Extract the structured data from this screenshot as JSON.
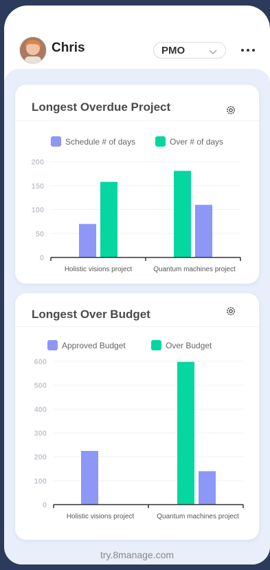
{
  "header": {
    "user_name": "Chris",
    "role": "PMO"
  },
  "cards": [
    {
      "title": "Longest Overdue Project"
    },
    {
      "title": "Longest Over Budget"
    }
  ],
  "footer": {
    "text": "try.8manage.com"
  },
  "chart_data": [
    {
      "type": "bar",
      "categories": [
        "Holistic visions project",
        "Quantum machines project"
      ],
      "series": [
        {
          "name": "Schedule # of days",
          "color": "#8c97f7",
          "values": [
            70,
            110
          ]
        },
        {
          "name": "Over # of days",
          "color": "#06d6a0",
          "values": [
            158,
            181
          ]
        }
      ],
      "bar_order": [
        [
          "Schedule # of days",
          "Over # of days"
        ],
        [
          "Over # of days",
          "Schedule # of days"
        ]
      ],
      "ylim": [
        0,
        200
      ],
      "yticks": [
        0,
        50,
        100,
        150,
        200
      ],
      "grid": true,
      "legend": "top"
    },
    {
      "type": "bar",
      "categories": [
        "Holistic visions project",
        "Quantum machines project"
      ],
      "series": [
        {
          "name": "Approved Budget",
          "color": "#8c97f7",
          "values": [
            0,
            140
          ]
        },
        {
          "name": "Over Budget",
          "color": "#06d6a0",
          "values": [
            225,
            598
          ]
        }
      ],
      "bar_order": [
        [
          "Over Budget",
          "Approved Budget"
        ],
        [
          "Over Budget",
          "Approved Budget"
        ]
      ],
      "bar_colors_override": [
        [
          "#8c97f7",
          null
        ],
        [
          null,
          null
        ]
      ],
      "ylim": [
        0,
        600
      ],
      "yticks": [
        0,
        100,
        200,
        300,
        400,
        500,
        600
      ],
      "grid": true,
      "legend": "top"
    }
  ]
}
